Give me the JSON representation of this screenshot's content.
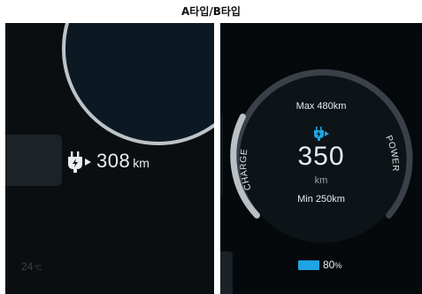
{
  "caption": "A타입/B타입",
  "panel_a": {
    "range_value": "308",
    "range_unit": "km",
    "temperature_value": "24",
    "temperature_unit": "℃",
    "icon": "plug-charge-icon"
  },
  "panel_b": {
    "max_label": "Max 480km",
    "range_value": "350",
    "range_unit": "km",
    "min_label": "Min 250km",
    "left_arc_label": "CHARGE",
    "right_arc_label": "POWER",
    "battery_percent": "80",
    "battery_unit": "%",
    "battery_level": 0.8,
    "icon": "plug-charge-icon"
  },
  "colors": {
    "accent": "#1fa3e2",
    "ring": "#bcc4c9",
    "gauge": "#3a4148",
    "background": "#0a0e11"
  }
}
